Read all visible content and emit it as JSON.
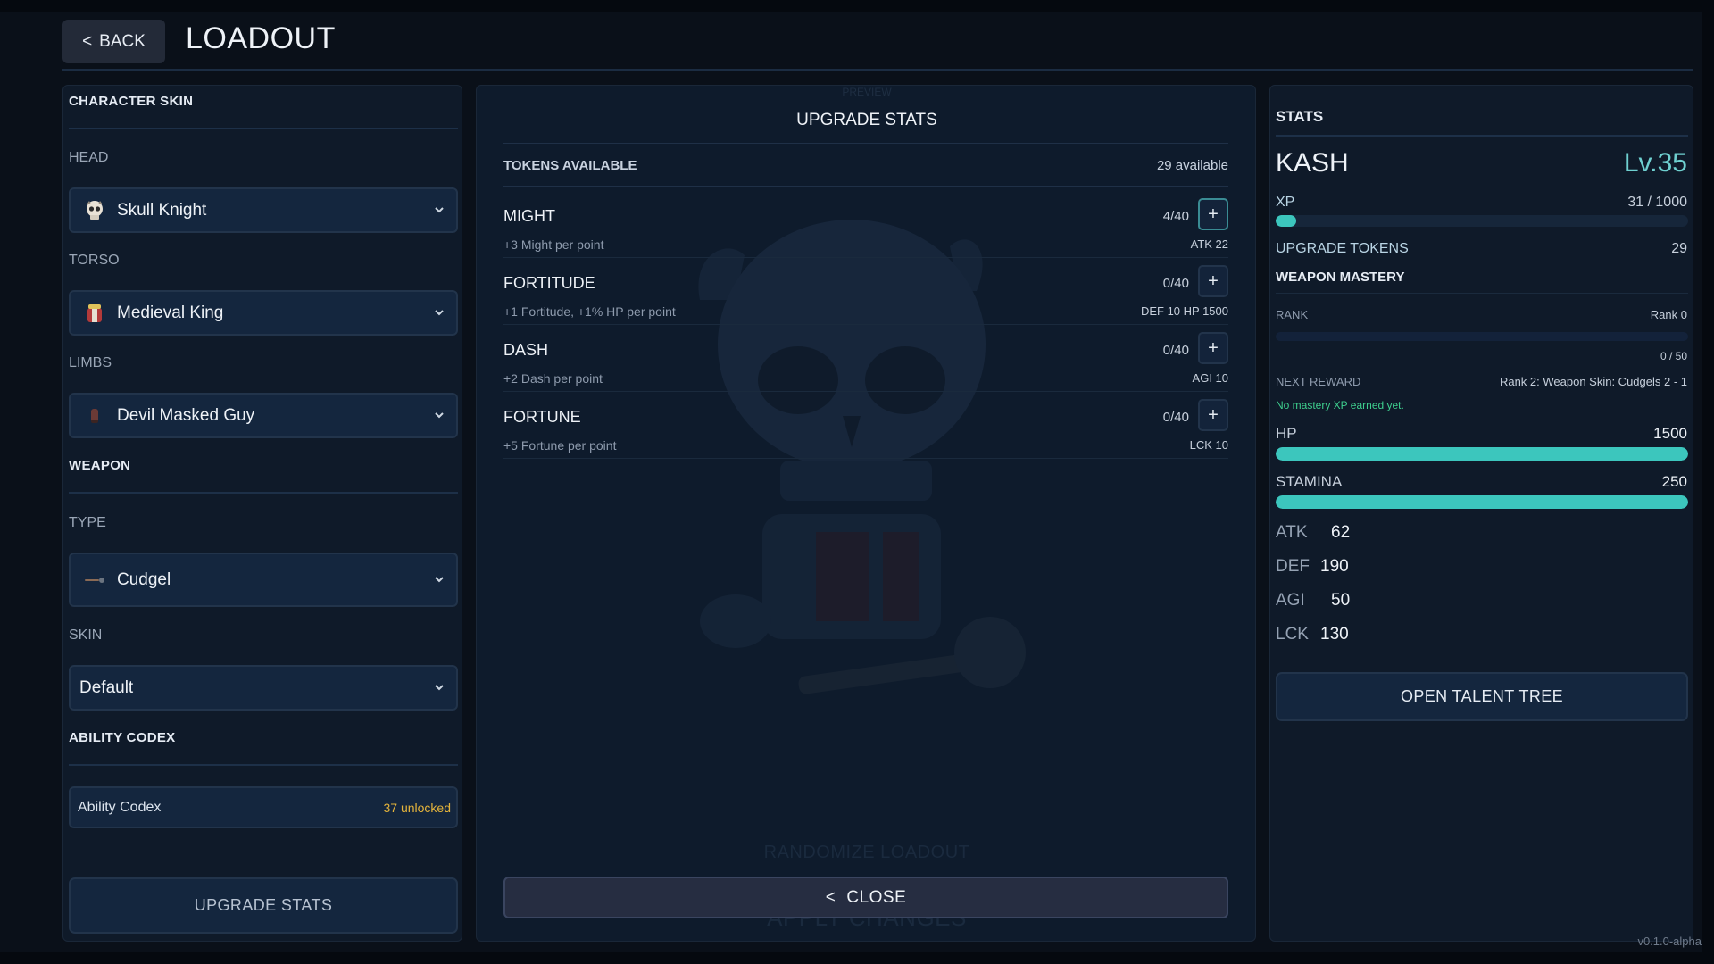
{
  "header": {
    "back_label": "BACK",
    "title": "LOADOUT"
  },
  "left": {
    "character_skin_title": "CHARACTER SKIN",
    "head": {
      "label": "HEAD",
      "value": "Skull Knight"
    },
    "torso": {
      "label": "TORSO",
      "value": "Medieval King"
    },
    "limbs": {
      "label": "LIMBS",
      "value": "Devil Masked Guy"
    },
    "weapon_title": "WEAPON",
    "type": {
      "label": "TYPE",
      "value": "Cudgel"
    },
    "skin": {
      "label": "SKIN",
      "value": "Default"
    },
    "ability_codex_title": "ABILITY CODEX",
    "codex": {
      "name": "Ability Codex",
      "count": "37 unlocked"
    },
    "upgrade_stats_button": "UPGRADE STATS"
  },
  "center": {
    "preview_label": "PREVIEW",
    "title": "UPGRADE STATS",
    "tokens_label": "TOKENS AVAILABLE",
    "tokens_value": "29 available",
    "stats": [
      {
        "name": "MIGHT",
        "desc": "+3 Might per point",
        "count": "4/40",
        "bonus": "ATK 22"
      },
      {
        "name": "FORTITUDE",
        "desc": "+1 Fortitude, +1% HP per point",
        "count": "0/40",
        "bonus": "DEF 10  HP 1500"
      },
      {
        "name": "DASH",
        "desc": "+2 Dash per point",
        "count": "0/40",
        "bonus": "AGI 10"
      },
      {
        "name": "FORTUNE",
        "desc": "+5 Fortune per point",
        "count": "0/40",
        "bonus": "LCK 10"
      }
    ],
    "plus_symbol": "+",
    "randomize_label": "RANDOMIZE LOADOUT",
    "apply_label": "APPLY CHANGES",
    "close_label": "CLOSE"
  },
  "right": {
    "title": "STATS",
    "name": "KASH",
    "level": "Lv.35",
    "xp_label": "XP",
    "xp_value": "31 / 1000",
    "xp_fraction": 0.031,
    "upgrade_tokens_label": "UPGRADE TOKENS",
    "upgrade_tokens_value": "29",
    "weapon_mastery_title": "WEAPON MASTERY",
    "rank_label": "RANK",
    "rank_value": "Rank 0",
    "mastery_progress": "0 / 50",
    "next_reward_label": "NEXT REWARD",
    "next_reward_value": "Rank 2: Weapon Skin: Cudgels 2 - 1",
    "mastery_note": "No mastery XP earned yet.",
    "hp_label": "HP",
    "hp_value": "1500",
    "stamina_label": "STAMINA",
    "stamina_value": "250",
    "attributes": [
      {
        "key": "ATK",
        "value": "62"
      },
      {
        "key": "DEF",
        "value": "190"
      },
      {
        "key": "AGI",
        "value": "50"
      },
      {
        "key": "LCK",
        "value": "130"
      }
    ],
    "talent_button": "OPEN TALENT TREE"
  },
  "version": "v0.1.0-alpha",
  "colors": {
    "accent": "#3cc6bd",
    "gold": "#e5b43b",
    "green": "#3ecf8e"
  }
}
